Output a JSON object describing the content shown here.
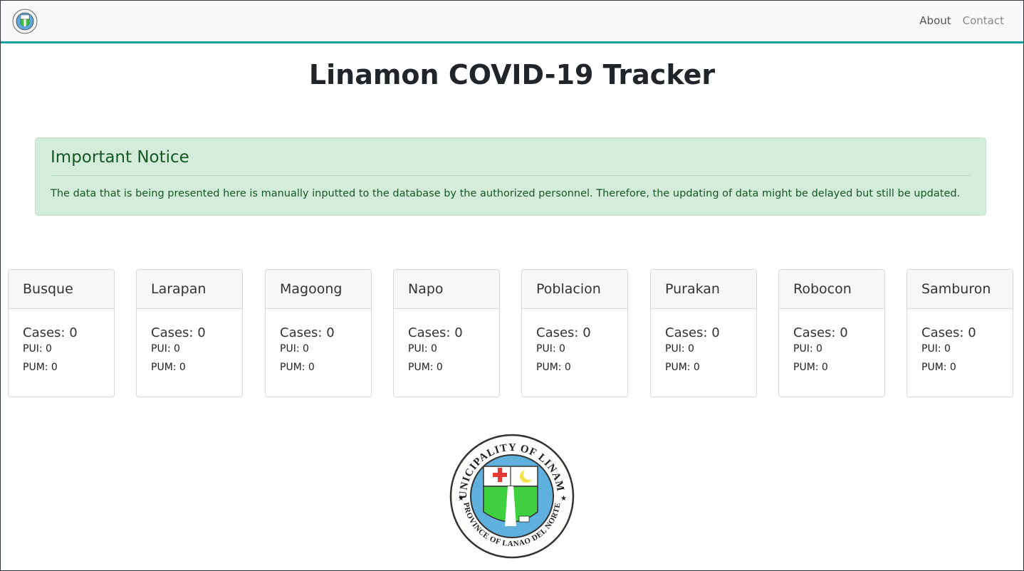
{
  "navbar": {
    "logo_icon": "municipal-seal-icon",
    "links": [
      {
        "label": "About"
      },
      {
        "label": "Contact"
      }
    ]
  },
  "title": "Linamon COVID-19 Tracker",
  "notice": {
    "heading": "Important Notice",
    "body": "The data that is being presented here is manually inputted to the database by the authorized personnel. Therefore, the updating of data might be delayed but still be updated."
  },
  "barangays": [
    {
      "name": "Busque",
      "cases": "Cases: 0",
      "pui": "PUI: 0",
      "pum": "PUM: 0"
    },
    {
      "name": "Larapan",
      "cases": "Cases: 0",
      "pui": "PUI: 0",
      "pum": "PUM: 0"
    },
    {
      "name": "Magoong",
      "cases": "Cases: 0",
      "pui": "PUI: 0",
      "pum": "PUM: 0"
    },
    {
      "name": "Napo",
      "cases": "Cases: 0",
      "pui": "PUI: 0",
      "pum": "PUM: 0"
    },
    {
      "name": "Poblacion",
      "cases": "Cases: 0",
      "pui": "PUI: 0",
      "pum": "PUM: 0"
    },
    {
      "name": "Purakan",
      "cases": "Cases: 0",
      "pui": "PUI: 0",
      "pum": "PUM: 0"
    },
    {
      "name": "Robocon",
      "cases": "Cases: 0",
      "pui": "PUI: 0",
      "pum": "PUM: 0"
    },
    {
      "name": "Samburon",
      "cases": "Cases: 0",
      "pui": "PUI: 0",
      "pum": "PUM: 0"
    }
  ],
  "seal": {
    "top_text": "MUNICIPALITY OF LINAMON",
    "bottom_text": "PROVINCE OF LANAO DEL NORTE"
  },
  "colors": {
    "accent": "#17a2a2",
    "alert_bg": "#d4edda",
    "alert_text": "#155724"
  }
}
